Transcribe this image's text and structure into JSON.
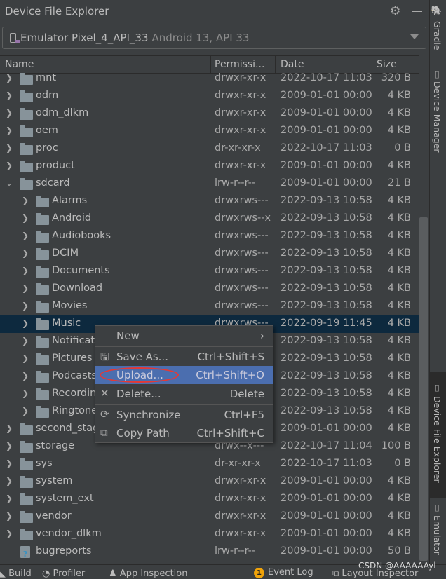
{
  "panel": {
    "title": "Device File Explorer"
  },
  "device": {
    "name": "Emulator Pixel_4_API_33",
    "detail": "Android 13, API 33"
  },
  "columns": {
    "name": "Name",
    "permissions": "Permissi...",
    "date": "Date",
    "size": "Size"
  },
  "rows": [
    {
      "name": "mnt",
      "perm": "drwxr-xr-x",
      "date": "2022-10-17 11:03",
      "size": "320 B",
      "level": 0,
      "state": "collapsed"
    },
    {
      "name": "odm",
      "perm": "drwxr-xr-x",
      "date": "2009-01-01 00:00",
      "size": "4 KB",
      "level": 0,
      "state": "collapsed"
    },
    {
      "name": "odm_dlkm",
      "perm": "drwxr-xr-x",
      "date": "2009-01-01 00:00",
      "size": "4 KB",
      "level": 0,
      "state": "collapsed"
    },
    {
      "name": "oem",
      "perm": "drwxr-xr-x",
      "date": "2009-01-01 00:00",
      "size": "4 KB",
      "level": 0,
      "state": "collapsed"
    },
    {
      "name": "proc",
      "perm": "dr-xr-xr-x",
      "date": "2022-10-17 11:03",
      "size": "0 B",
      "level": 0,
      "state": "collapsed"
    },
    {
      "name": "product",
      "perm": "drwxr-xr-x",
      "date": "2009-01-01 00:00",
      "size": "4 KB",
      "level": 0,
      "state": "collapsed"
    },
    {
      "name": "sdcard",
      "perm": "lrw-r--r--",
      "date": "2009-01-01 00:00",
      "size": "21 B",
      "level": 0,
      "state": "expanded"
    },
    {
      "name": "Alarms",
      "perm": "drwxrws---",
      "date": "2022-09-13 10:58",
      "size": "4 KB",
      "level": 1,
      "state": "collapsed"
    },
    {
      "name": "Android",
      "perm": "drwxrws--x",
      "date": "2022-09-13 10:58",
      "size": "4 KB",
      "level": 1,
      "state": "collapsed"
    },
    {
      "name": "Audiobooks",
      "perm": "drwxrws---",
      "date": "2022-09-13 10:58",
      "size": "4 KB",
      "level": 1,
      "state": "collapsed"
    },
    {
      "name": "DCIM",
      "perm": "drwxrws---",
      "date": "2022-09-13 10:58",
      "size": "4 KB",
      "level": 1,
      "state": "collapsed"
    },
    {
      "name": "Documents",
      "perm": "drwxrws---",
      "date": "2022-09-13 10:58",
      "size": "4 KB",
      "level": 1,
      "state": "collapsed"
    },
    {
      "name": "Download",
      "perm": "drwxrws---",
      "date": "2022-09-13 10:58",
      "size": "4 KB",
      "level": 1,
      "state": "collapsed"
    },
    {
      "name": "Movies",
      "perm": "drwxrws---",
      "date": "2022-09-13 10:58",
      "size": "4 KB",
      "level": 1,
      "state": "collapsed"
    },
    {
      "name": "Music",
      "perm": "drwxrws---",
      "date": "2022-09-19 11:45",
      "size": "4 KB",
      "level": 1,
      "state": "collapsed",
      "selected": true
    },
    {
      "name": "Notifications",
      "perm": "drwxrws---",
      "date": "2022-09-13 10:58",
      "size": "4 KB",
      "level": 1,
      "state": "collapsed"
    },
    {
      "name": "Pictures",
      "perm": "drwxrws---",
      "date": "2022-09-13 10:58",
      "size": "4 KB",
      "level": 1,
      "state": "collapsed"
    },
    {
      "name": "Podcasts",
      "perm": "drwxrws---",
      "date": "2022-09-13 10:58",
      "size": "4 KB",
      "level": 1,
      "state": "collapsed"
    },
    {
      "name": "Recordings",
      "perm": "drwxrws---",
      "date": "2022-09-13 10:58",
      "size": "4 KB",
      "level": 1,
      "state": "collapsed"
    },
    {
      "name": "Ringtones",
      "perm": "drwxrws---",
      "date": "2022-09-13 10:58",
      "size": "4 KB",
      "level": 1,
      "state": "collapsed"
    },
    {
      "name": "second_stage_resources",
      "perm": "drwxr-xr-x",
      "date": "2009-01-01 00:00",
      "size": "4 KB",
      "level": 0,
      "state": "collapsed"
    },
    {
      "name": "storage",
      "perm": "drwx--x---",
      "date": "2022-10-17 11:04",
      "size": "100 B",
      "level": 0,
      "state": "collapsed"
    },
    {
      "name": "sys",
      "perm": "dr-xr-xr-x",
      "date": "2022-10-17 11:03",
      "size": "0 B",
      "level": 0,
      "state": "collapsed"
    },
    {
      "name": "system",
      "perm": "drwxr-xr-x",
      "date": "2009-01-01 00:00",
      "size": "4 KB",
      "level": 0,
      "state": "collapsed"
    },
    {
      "name": "system_ext",
      "perm": "drwxr-xr-x",
      "date": "2009-01-01 00:00",
      "size": "4 KB",
      "level": 0,
      "state": "collapsed"
    },
    {
      "name": "vendor",
      "perm": "drwxr-xr-x",
      "date": "2009-01-01 00:00",
      "size": "4 KB",
      "level": 0,
      "state": "collapsed"
    },
    {
      "name": "vendor_dlkm",
      "perm": "drwxr-xr-x",
      "date": "2009-01-01 00:00",
      "size": "4 KB",
      "level": 0,
      "state": "collapsed"
    },
    {
      "name": "bugreports",
      "perm": "lrw-r--r--",
      "date": "2009-01-01 00:00",
      "size": "50 B",
      "level": 0,
      "state": "file"
    }
  ],
  "context_menu": {
    "new": "New",
    "save_as": {
      "label": "Save As...",
      "shortcut": "Ctrl+Shift+S"
    },
    "upload": {
      "label": "Upload...",
      "shortcut": "Ctrl+Shift+O"
    },
    "delete": {
      "label": "Delete...",
      "shortcut": "Delete"
    },
    "synchronize": {
      "label": "Synchronize",
      "shortcut": "Ctrl+F5"
    },
    "copy_path": {
      "label": "Copy Path",
      "shortcut": "Ctrl+Shift+C"
    }
  },
  "right_strip": {
    "gradle": "Gradle",
    "device_manager": "Device Manager",
    "device_file_explorer": "Device File Explorer",
    "emulator": "Emulator"
  },
  "bottom_bar": {
    "build": "Build",
    "profiler": "Profiler",
    "app_inspection": "App Inspection",
    "event_log_count": "1",
    "event_log": "Event Log",
    "layout_inspector": "Layout Inspector"
  },
  "watermark": "CSDN @AAAAAAyl",
  "colors": {
    "selection": "#0d293e",
    "menu_highlight": "#4b6eaf",
    "annotation": "#e53935"
  }
}
